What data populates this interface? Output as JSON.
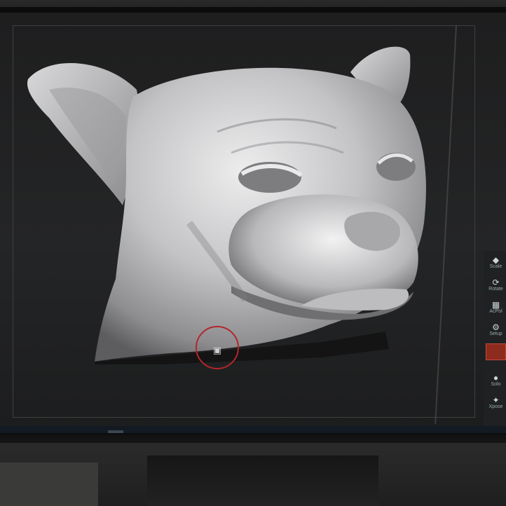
{
  "window": {
    "title": ""
  },
  "viewport": {
    "model": "dog head sculpt",
    "brush_cursor": "brush-cursor-icon"
  },
  "right_shelf": {
    "items": [
      {
        "label": "Scale",
        "icon": "scale-icon"
      },
      {
        "label": "Rotate",
        "icon": "rotate-icon"
      },
      {
        "label": "AcPol",
        "icon": "polyframe-icon"
      },
      {
        "label": "Setup",
        "icon": "setup-icon"
      },
      {
        "label": "",
        "icon": "material-swatch-icon"
      },
      {
        "label": "Solo",
        "icon": "solo-icon"
      },
      {
        "label": "Xpose",
        "icon": "xpose-icon"
      }
    ]
  },
  "taskbar": {
    "items": [
      {
        "icon": "edge-icon",
        "active": false
      },
      {
        "icon": "file-explorer-icon",
        "active": false
      },
      {
        "icon": "store-icon",
        "active": false
      },
      {
        "icon": "photoshop-icon",
        "active": false
      },
      {
        "icon": "mail-icon",
        "active": false
      },
      {
        "icon": "zbrush-icon",
        "active": true
      },
      {
        "icon": "refresh-app-icon",
        "active": false
      },
      {
        "icon": "photos-icon",
        "active": false
      }
    ]
  },
  "colors": {
    "viewport_bg": "#242526",
    "sculpt_clay": "#c8c8ca",
    "brush_ring": "#b3262a",
    "taskbar_bg": "#141a22",
    "shelf_red": "#8e2b1f"
  }
}
